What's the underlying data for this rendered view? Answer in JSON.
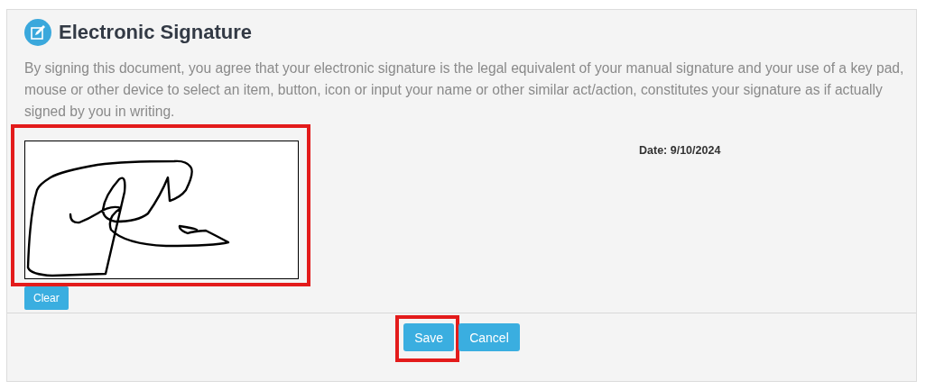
{
  "section": {
    "title": "Electronic Signature",
    "disclaimer": "By signing this document, you agree that your electronic signature is the legal equivalent of your manual signature and your use of a key pad, mouse or other device to select an item, button, icon or input your name or other similar act/action, constitutes your signature as if actually signed by you in writing."
  },
  "signature_pad": {
    "highlighted": true
  },
  "clear_button": "Clear",
  "date": "Date: 9/10/2024",
  "buttons": [
    {
      "label": "Save",
      "highlighted": true
    },
    {
      "label": "Cancel",
      "highlighted": false
    }
  ]
}
